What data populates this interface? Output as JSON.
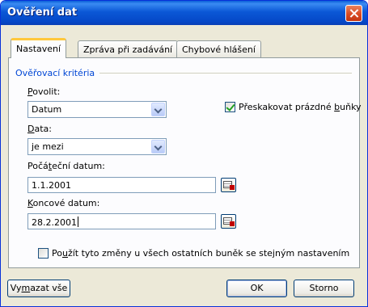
{
  "window": {
    "title": "Ověření dat"
  },
  "tabs": [
    {
      "label": "Nastavení",
      "active": true
    },
    {
      "label": "Zpráva při zadávání",
      "active": false
    },
    {
      "label": "Chybové hlášení",
      "active": false
    }
  ],
  "criteria": {
    "group_title": "Ověřovací kritéria",
    "allow": {
      "label_u": "P",
      "label_rest": "ovolit:",
      "value": "Datum"
    },
    "ignore_blank": {
      "label_pre": "Přeskakovat prázdné ",
      "label_u": "b",
      "label_post": "uňky",
      "checked": true
    },
    "data": {
      "label_u": "D",
      "label_rest": "ata:",
      "value": "je mezi"
    },
    "start_date": {
      "label_pre": "Počá",
      "label_u": "t",
      "label_post": "eční datum:",
      "value": "1.1.2001"
    },
    "end_date": {
      "label_u": "K",
      "label_rest": "oncové datum:",
      "value": "28.2.2001"
    }
  },
  "apply_all": {
    "label_pre": "Po",
    "label_u": "u",
    "label_post": "žít tyto změny u všech ostatních buněk se stejným nastavením",
    "checked": false
  },
  "buttons": {
    "clear_pre": "Vy",
    "clear_u": "m",
    "clear_post": "azat vše",
    "ok": "OK",
    "cancel": "Storno"
  },
  "icons": {
    "close": "close-icon",
    "dropdown": "chevron-down-icon",
    "range_ref": "range-selector-icon",
    "checkbox": "checkbox-icon"
  },
  "colors": {
    "titlebar": "#0b58d6",
    "dialog_bg": "#ece9d8",
    "group_title": "#0046d5",
    "active_tab_accent": "#ffc83c",
    "check": "#21a121"
  }
}
